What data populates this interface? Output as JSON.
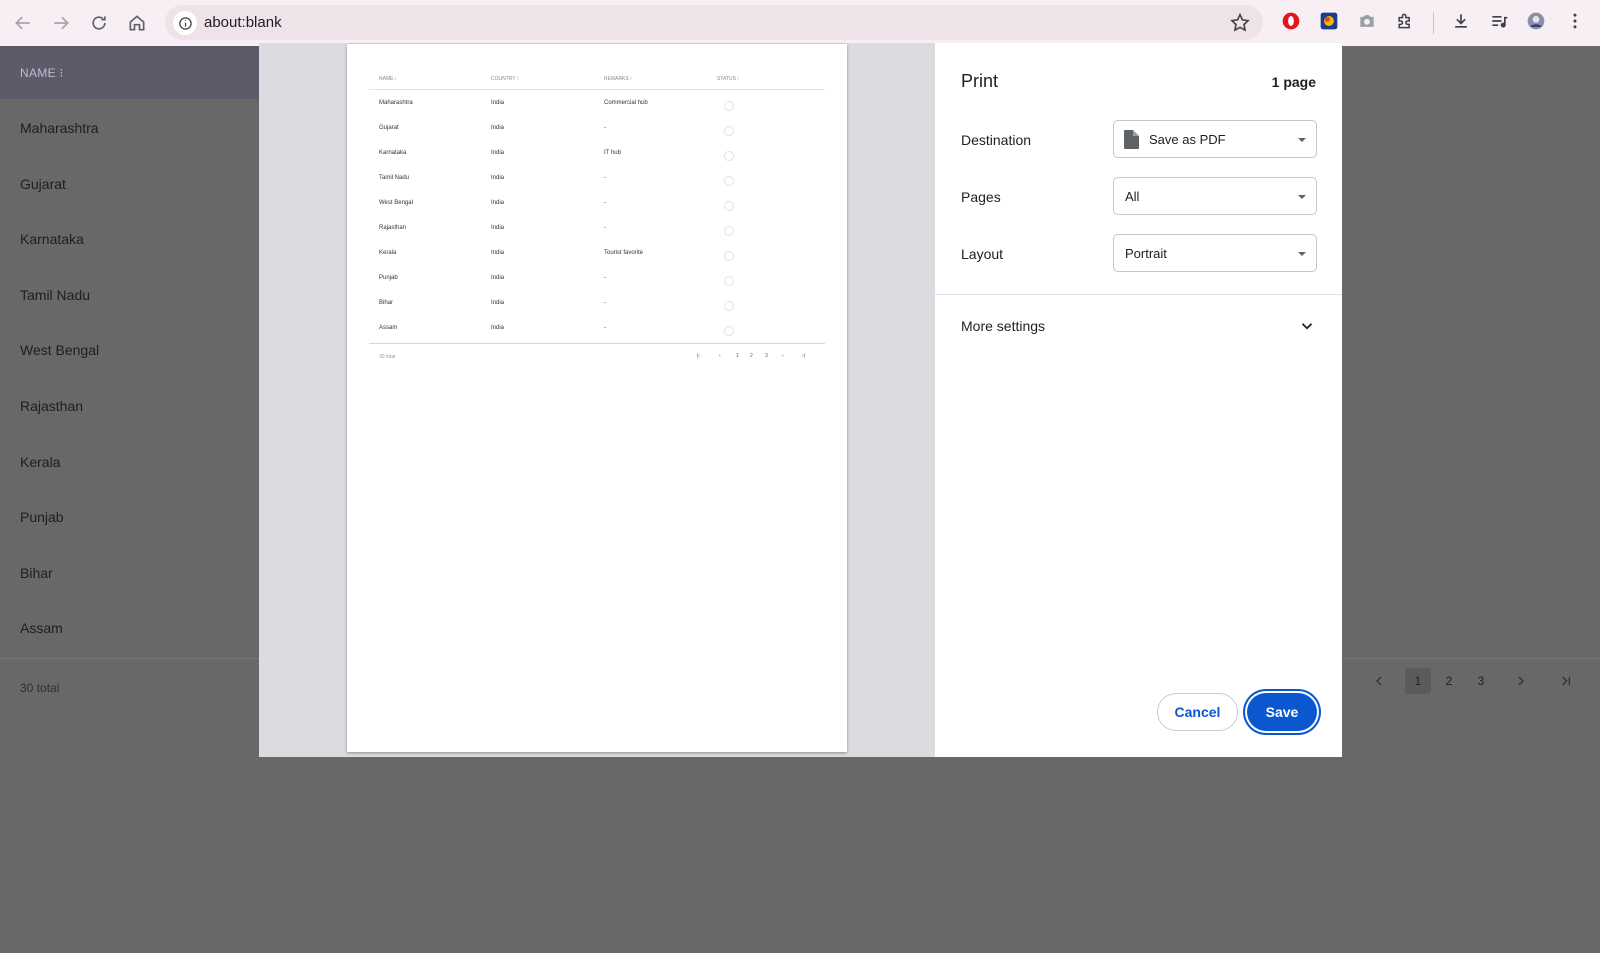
{
  "browser": {
    "url": "about:blank",
    "icons": {
      "back": "back-arrow-icon",
      "forward": "forward-arrow-icon",
      "reload": "reload-icon",
      "home": "home-icon",
      "info": "info-icon",
      "bookmark": "star-icon",
      "extensions": [
        "opera-extension-icon",
        "colorful-extension-icon",
        "camera-icon",
        "puzzle-icon"
      ],
      "download": "download-icon",
      "media": "media-control-icon",
      "profile": "profile-avatar",
      "menu": "kebab-menu-icon"
    }
  },
  "background": {
    "column_header": "NAME ⁝",
    "rows": [
      "Maharashtra",
      "Gujarat",
      "Karnataka",
      "Tamil Nadu",
      "West Bengal",
      "Rajasthan",
      "Kerala",
      "Punjab",
      "Bihar",
      "Assam"
    ],
    "total": "30 total",
    "pager": {
      "pages": [
        "1",
        "2",
        "3"
      ],
      "active": "1"
    }
  },
  "preview": {
    "headers": [
      "NAME ⁝",
      "COUNTRY ⁝",
      "REMARKS ⁝",
      "STATUS ⁝"
    ],
    "rows": [
      {
        "name": "Maharashtra",
        "country": "India",
        "remarks": "Commercial hub"
      },
      {
        "name": "Gujarat",
        "country": "India",
        "remarks": "-"
      },
      {
        "name": "Karnataka",
        "country": "India",
        "remarks": "IT hub"
      },
      {
        "name": "Tamil Nadu",
        "country": "India",
        "remarks": "-"
      },
      {
        "name": "West Bengal",
        "country": "India",
        "remarks": "-"
      },
      {
        "name": "Rajasthan",
        "country": "India",
        "remarks": "-"
      },
      {
        "name": "Kerala",
        "country": "India",
        "remarks": "Tourist favorite"
      },
      {
        "name": "Punjab",
        "country": "India",
        "remarks": "-"
      },
      {
        "name": "Bihar",
        "country": "India",
        "remarks": "-"
      },
      {
        "name": "Assam",
        "country": "India",
        "remarks": "-"
      }
    ],
    "total": "30 total",
    "pager": [
      "1",
      "2",
      "3"
    ]
  },
  "print": {
    "title": "Print",
    "page_count": "1 page",
    "destination_label": "Destination",
    "destination_value": "Save as PDF",
    "pages_label": "Pages",
    "pages_value": "All",
    "layout_label": "Layout",
    "layout_value": "Portrait",
    "more_settings": "More settings",
    "cancel": "Cancel",
    "save": "Save"
  },
  "colors": {
    "accent": "#0b57d0",
    "toolbar_bg": "#f8eff4",
    "scrim": "#686868"
  }
}
